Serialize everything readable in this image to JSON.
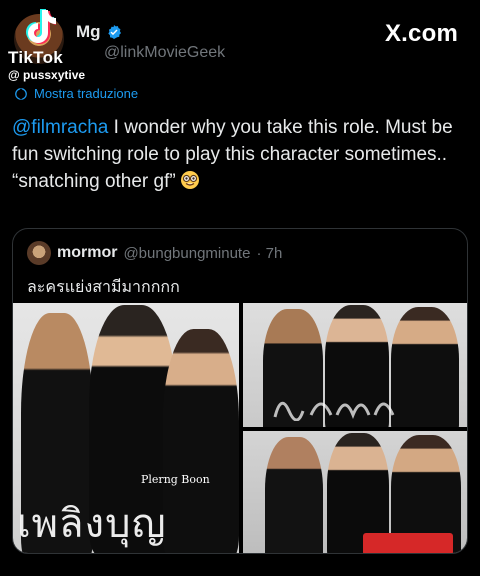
{
  "overlay": {
    "brand": "TikTok",
    "username": "@ pussxytive"
  },
  "header": {
    "author_name": "Mg",
    "author_handle": "@linkMovieGeek",
    "site": "X.com"
  },
  "translate_label": "Mostra traduzione",
  "tweet": {
    "mention": "@filmracha",
    "text": " I wonder why you take this role. Must be fun switching role to play this character sometimes.. “snatching other gf”"
  },
  "quote": {
    "name": "mormor",
    "handle": "@bungbungminute",
    "time": "· 7h",
    "text": "ละครแย่งสามีมากกกก"
  },
  "poster": {
    "credit": "Plerng Boon",
    "title": "เพลิงบุญ"
  },
  "colors": {
    "accent": "#1d9bf0",
    "muted": "#71767b",
    "background": "#000000"
  }
}
